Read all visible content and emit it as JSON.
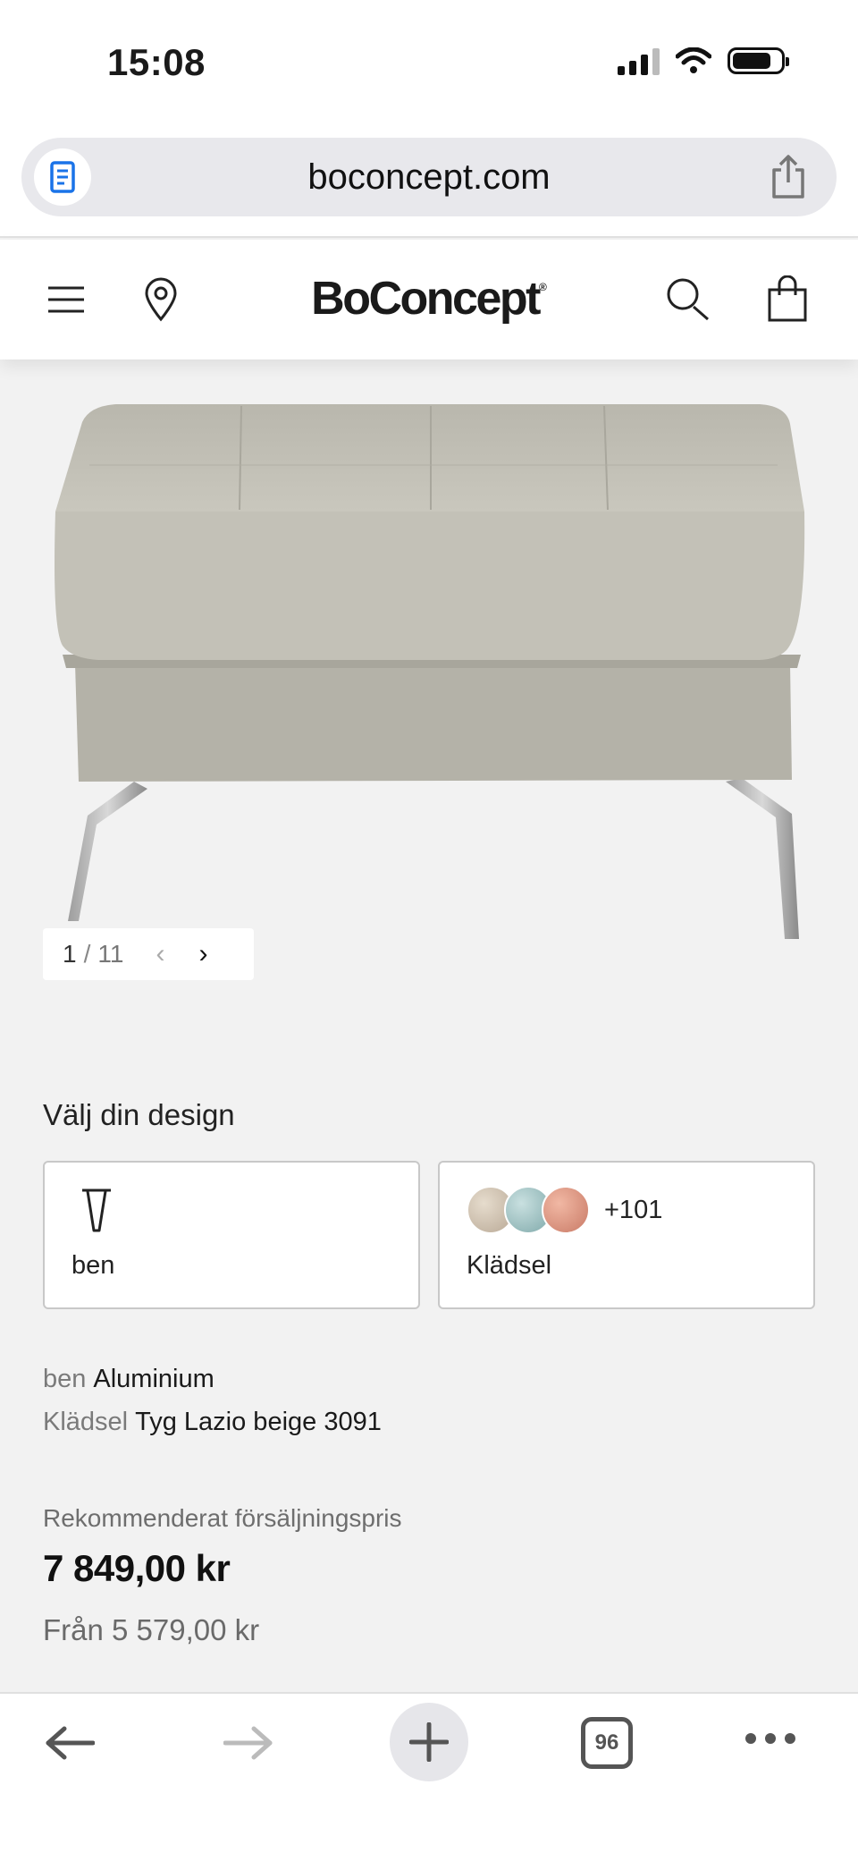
{
  "status_bar": {
    "time": "15:08"
  },
  "browser": {
    "url": "boconcept.com",
    "tab_count": "96"
  },
  "header": {
    "brand": "BoConcept",
    "brand_mark": "®"
  },
  "gallery": {
    "current": "1",
    "separator": "/",
    "total": "11",
    "prev_icon": "chevron-left-icon",
    "next_icon": "chevron-right-icon"
  },
  "design": {
    "title": "Välj din design",
    "options": [
      {
        "label": "ben",
        "icon": "leg-icon"
      },
      {
        "label": "Klädsel",
        "extra": "+101"
      }
    ]
  },
  "specs": [
    {
      "key": "ben",
      "value": "Aluminium"
    },
    {
      "key": "Klädsel",
      "value": "Tyg Lazio beige 3091"
    }
  ],
  "pricing": {
    "label": "Rekommenderat försäljningspris",
    "price": "7 849,00 kr",
    "from": "Från 5 579,00 kr"
  },
  "colors": {
    "accent_blue": "#1a73e8",
    "text": "#1a1a1a",
    "muted": "#7a7a7a",
    "background": "#f2f2f2"
  }
}
